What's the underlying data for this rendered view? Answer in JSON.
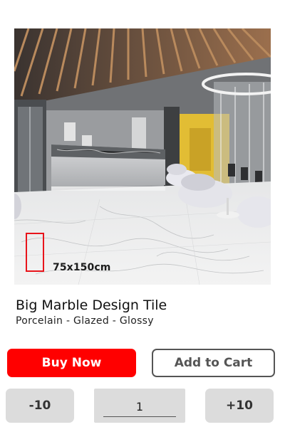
{
  "product": {
    "image_label": "75x150cm",
    "title": "Big Marble Design Tile",
    "subtitle": "Porcelain - Glazed - Glossy"
  },
  "actions": {
    "buy_now_label": "Buy Now",
    "add_to_cart_label": "Add to Cart"
  },
  "quantity": {
    "decrement_label": "-10",
    "value": "1",
    "increment_label": "+10"
  },
  "colors": {
    "buy_button": "#ff0000",
    "size_marker": "#e8141b",
    "secondary_button_border": "#555555",
    "quantity_background": "#dcdcdc"
  }
}
